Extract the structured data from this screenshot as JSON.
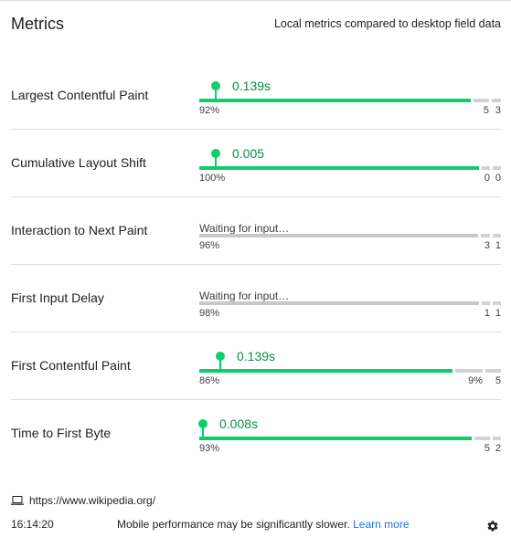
{
  "header": {
    "title": "Metrics",
    "subtitle": "Local metrics compared to desktop field data"
  },
  "metrics": [
    {
      "name": "Largest Contentful Paint",
      "value": "0.139s",
      "waiting": null,
      "status": "good",
      "local_value_position_fraction": 0.055,
      "distribution": [
        0.92,
        0.05,
        0.03
      ],
      "distribution_labels": [
        "92%",
        "5",
        "3"
      ]
    },
    {
      "name": "Cumulative Layout Shift",
      "value": "0.005",
      "waiting": null,
      "status": "good",
      "local_value_position_fraction": 0.055,
      "distribution": [
        1.0,
        0.0,
        0.0
      ],
      "distribution_labels": [
        "100%",
        "0",
        "0"
      ]
    },
    {
      "name": "Interaction to Next Paint",
      "value": null,
      "waiting": "Waiting for input…",
      "status": "none",
      "distribution": [
        0.96,
        0.03,
        0.01
      ],
      "distribution_labels": [
        "96%",
        "3",
        "1"
      ]
    },
    {
      "name": "First Input Delay",
      "value": null,
      "waiting": "Waiting for input…",
      "status": "none",
      "distribution": [
        0.98,
        0.01,
        0.01
      ],
      "distribution_labels": [
        "98%",
        "1",
        "1"
      ]
    },
    {
      "name": "First Contentful Paint",
      "value": "0.139s",
      "waiting": null,
      "status": "good",
      "local_value_position_fraction": 0.07,
      "distribution": [
        0.86,
        0.09,
        0.05
      ],
      "distribution_labels": [
        "86%",
        "9%",
        "5"
      ]
    },
    {
      "name": "Time to First Byte",
      "value": "0.008s",
      "waiting": null,
      "status": "good",
      "local_value_position_fraction": 0.012,
      "distribution": [
        0.93,
        0.05,
        0.02
      ],
      "distribution_labels": [
        "93%",
        "5",
        "2"
      ]
    }
  ],
  "footer": {
    "url": "https://www.wikipedia.org/",
    "device_icon": "laptop-icon",
    "time": "16:14:20",
    "note": "Mobile performance may be significantly slower.",
    "learn_more": "Learn more",
    "settings_icon": "gear-icon"
  },
  "colors": {
    "good": "#0cce6b",
    "good_text": "#0a8f46",
    "neutral": "#c8c8c8",
    "link": "#1a73e8"
  }
}
